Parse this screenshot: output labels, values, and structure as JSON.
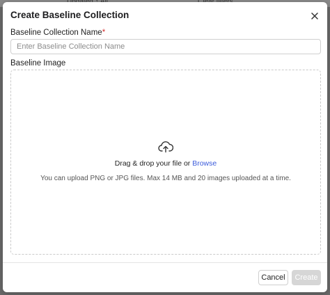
{
  "background": {
    "ghost_text_left": "Updated ↑ All",
    "ghost_text_right": "Clear filters"
  },
  "modal": {
    "title": "Create Baseline Collection",
    "close_icon": "close-icon"
  },
  "form": {
    "name_label": "Baseline Collection Name",
    "required_marker": "*",
    "name_value": "",
    "name_placeholder": "Enter Baseline Collection Name",
    "image_label": "Baseline Image"
  },
  "dropzone": {
    "icon": "cloud-upload-icon",
    "drop_text": "Drag & drop your file or ",
    "browse_label": "Browse",
    "hint": "You can upload PNG or JPG files. Max 14 MB and 20 images uploaded at a time."
  },
  "footer": {
    "cancel_label": "Cancel",
    "create_label": "Create"
  },
  "colors": {
    "link": "#3b5bdb",
    "required": "#d32f2f",
    "create_disabled_bg": "#d6d6d6"
  }
}
